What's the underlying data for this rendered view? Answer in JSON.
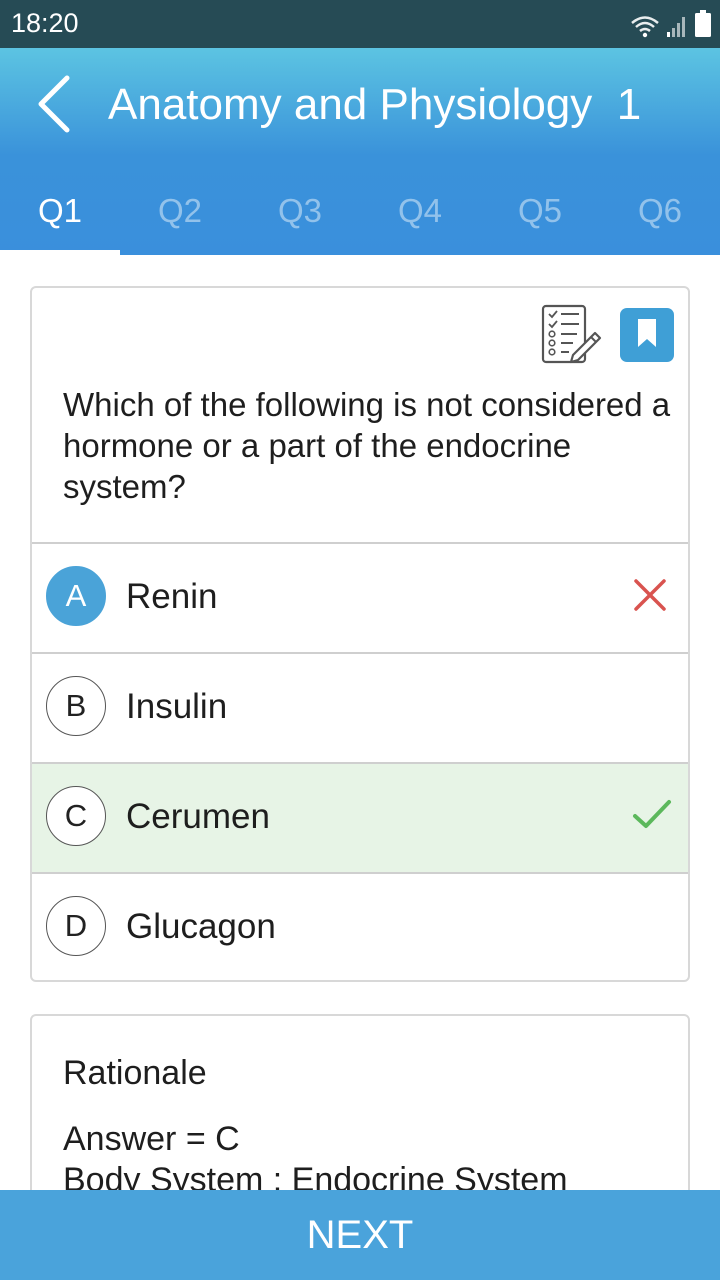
{
  "status_bar": {
    "time": "18:20",
    "icons": [
      "wifi-icon",
      "signal-icon",
      "battery-icon"
    ]
  },
  "header": {
    "title": "Anatomy and Physiology  1",
    "back_icon": "chevron-left-icon"
  },
  "tabs": [
    {
      "label": "Q1",
      "active": true
    },
    {
      "label": "Q2",
      "active": false
    },
    {
      "label": "Q3",
      "active": false
    },
    {
      "label": "Q4",
      "active": false
    },
    {
      "label": "Q5",
      "active": false
    },
    {
      "label": "Q6",
      "active": false
    }
  ],
  "question": {
    "text": "Which of the following is not considered a hormone or a part of the endocrine system?",
    "icons": [
      "checklist-notes-icon",
      "bookmark-icon"
    ],
    "options": [
      {
        "letter": "A",
        "text": "Renin",
        "selected": true,
        "state": "incorrect"
      },
      {
        "letter": "B",
        "text": "Insulin",
        "selected": false,
        "state": "none"
      },
      {
        "letter": "C",
        "text": "Cerumen",
        "selected": false,
        "state": "correct"
      },
      {
        "letter": "D",
        "text": "Glucagon",
        "selected": false,
        "state": "none"
      }
    ]
  },
  "rationale": {
    "title": "Rationale",
    "lines": [
      "Answer = C",
      "Body System : Endocrine System"
    ]
  },
  "footer": {
    "next_label": "NEXT"
  },
  "colors": {
    "status_bar": "#264b55",
    "header_top": "#5cc4e2",
    "header_bottom": "#3a8fdc",
    "accent": "#4aa3db",
    "correct_bg": "#e7f4e6",
    "correct_mark": "#5cb85c",
    "incorrect_mark": "#d9534f"
  }
}
